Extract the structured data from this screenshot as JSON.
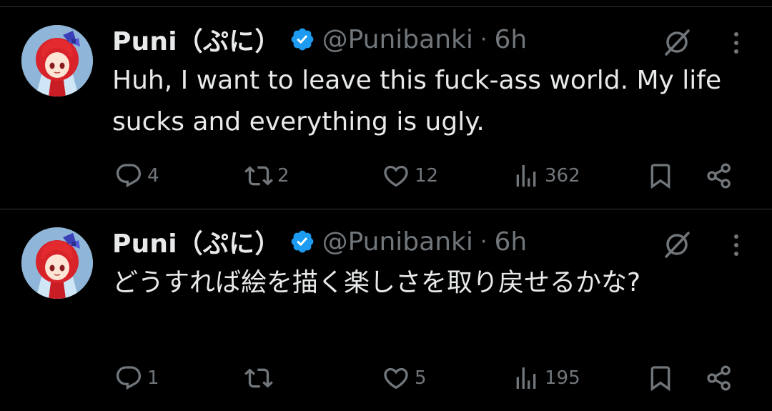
{
  "colors": {
    "background": "#000000",
    "text": "#e7e9ea",
    "muted": "#71767b",
    "verified": "#1d9bf0",
    "divider": "#2f3336"
  },
  "tweets": [
    {
      "display_name": "Puni（ぷに）",
      "handle": "@Punibanki",
      "separator": "·",
      "time": "6h",
      "text": "Huh, I want to leave this fuck-ass world. My life sucks and everything is ugly.",
      "replies": "4",
      "reposts": "2",
      "likes": "12",
      "views": "362"
    },
    {
      "display_name": "Puni（ぷに）",
      "handle": "@Punibanki",
      "separator": "·",
      "time": "6h",
      "text": "どうすれば絵を描く楽しさを取り戻せるかな?",
      "replies": "1",
      "reposts": "",
      "likes": "5",
      "views": "195"
    }
  ],
  "icons": {
    "verified": "verified-badge-icon",
    "grok": "grok-icon",
    "more": "more-icon",
    "reply": "reply-icon",
    "repost": "repost-icon",
    "like": "heart-icon",
    "views": "views-icon",
    "bookmark": "bookmark-icon",
    "share": "share-icon"
  }
}
